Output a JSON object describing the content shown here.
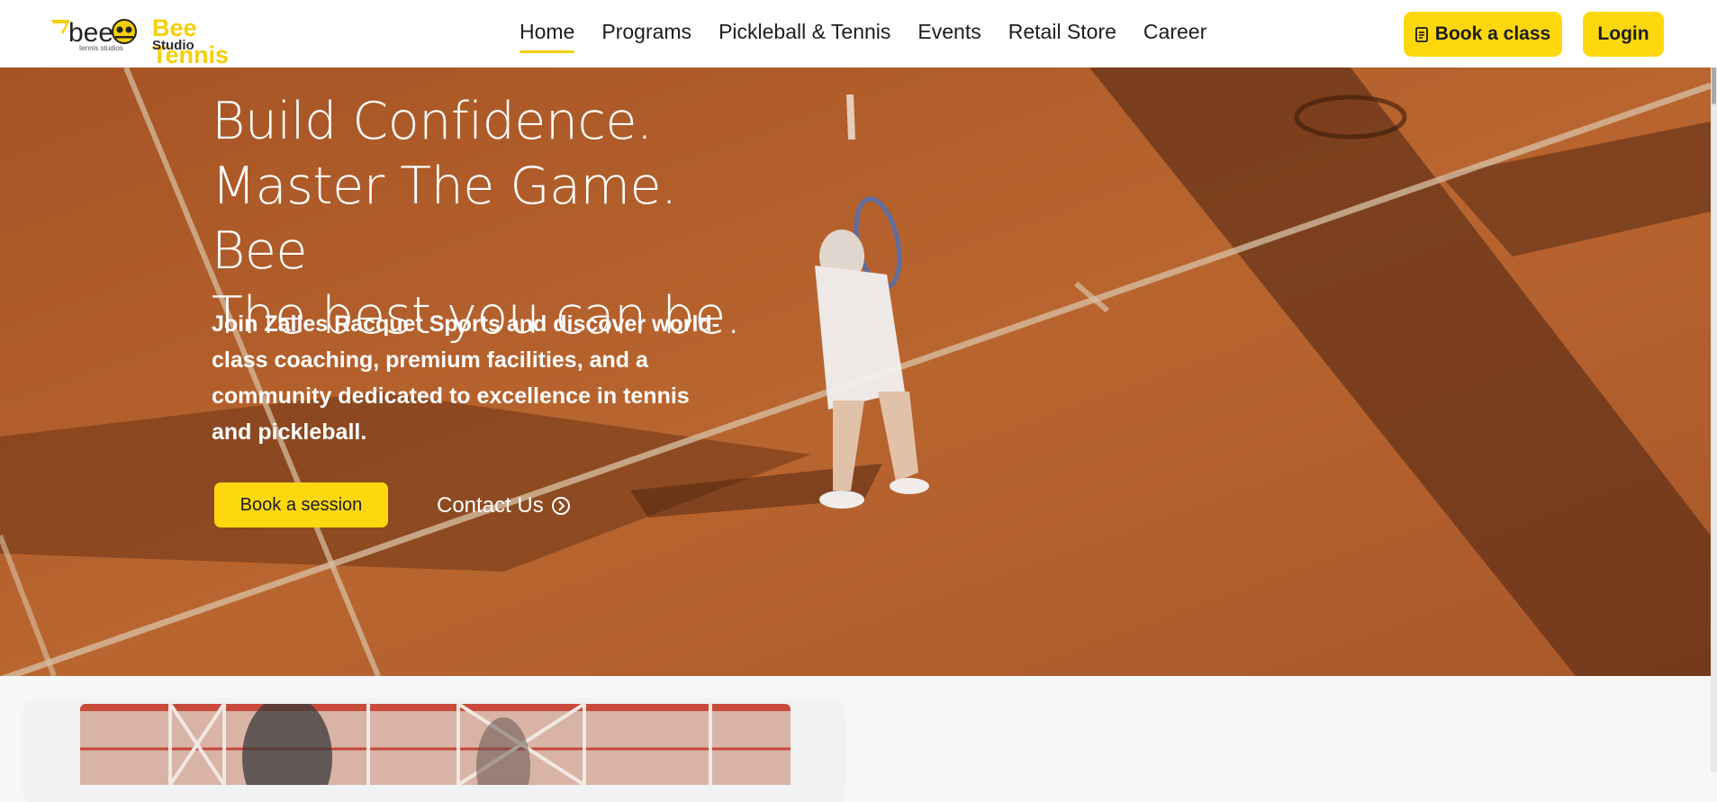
{
  "brand": {
    "logo_word": "bee",
    "logo_tagline": "tennis studios",
    "name": "Bee Tennis",
    "sub": "Studio"
  },
  "nav": {
    "items": [
      {
        "label": "Home",
        "active": true
      },
      {
        "label": "Programs",
        "active": false
      },
      {
        "label": "Pickleball & Tennis",
        "active": false
      },
      {
        "label": "Events",
        "active": false
      },
      {
        "label": "Retail Store",
        "active": false
      },
      {
        "label": "Career",
        "active": false
      }
    ],
    "book_class_label": "Book a class",
    "login_label": "Login"
  },
  "hero": {
    "title_line1": "Build Confidence.",
    "title_line2": "Master The Game. Bee",
    "title_line3": "The best you can be.",
    "description": "Join Zalles Racquet Sports and discover world-class coaching, premium facilities, and a community dedicated to excellence in tennis and pickleball.",
    "primary_button": "Book a session",
    "secondary_link": "Contact Us"
  },
  "colors": {
    "accent": "#fdd80f",
    "brand_yellow": "#f5cf07",
    "court_clay": "#b45f2d",
    "text_dark": "#1d1d1d"
  },
  "icons": {
    "book_class": "document-icon",
    "contact": "arrow-circle-right-icon"
  }
}
